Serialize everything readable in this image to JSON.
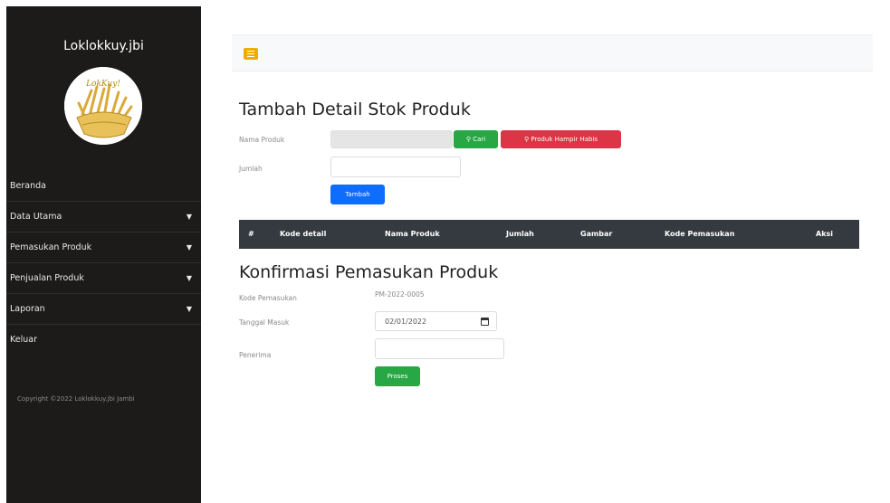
{
  "sidebar": {
    "brand": "Loklokkuy.jbi",
    "logo_text": "LokKuy!",
    "menu": [
      {
        "label": "Beranda",
        "has_caret": false
      },
      {
        "label": "Data Utama",
        "has_caret": true
      },
      {
        "label": "Pemasukan Produk",
        "has_caret": true
      },
      {
        "label": "Penjualan Produk",
        "has_caret": true
      },
      {
        "label": "Laporan",
        "has_caret": true
      },
      {
        "label": "Keluar",
        "has_caret": false
      }
    ],
    "copyright": "Copyright ©2022 Loklokkuy.jbi Jambi"
  },
  "topbar": {
    "toggler_icon": "hamburger-icon",
    "accent": "#f0ad00"
  },
  "detail_form": {
    "title": "Tambah Detail Stok Produk",
    "nama_produk_label": "Nama Produk",
    "nama_produk_value": "",
    "cari_button": "Cari",
    "hampir_habis_button": "Produk Hampir Habis",
    "jumlah_label": "Jumlah",
    "jumlah_value": "",
    "tambah_button": "Tambah"
  },
  "table": {
    "headers": [
      "#",
      "Kode detail",
      "Nama Produk",
      "Jumlah",
      "Gambar",
      "Kode Pemasukan",
      "Aksi"
    ],
    "rows": []
  },
  "confirm_form": {
    "title": "Konfirmasi Pemasukan Produk",
    "kode_label": "Kode Pemasukan",
    "kode_value": "PM-2022-0005",
    "tanggal_label": "Tanggal Masuk",
    "tanggal_value": "02/01/2022",
    "penerima_label": "Penerima",
    "penerima_value": "",
    "proses_button": "Proses"
  },
  "colors": {
    "sidebar_bg": "#1c1b1a",
    "success": "#28a745",
    "danger": "#dc3545",
    "primary": "#0d6efd",
    "table_head": "#343a40"
  }
}
